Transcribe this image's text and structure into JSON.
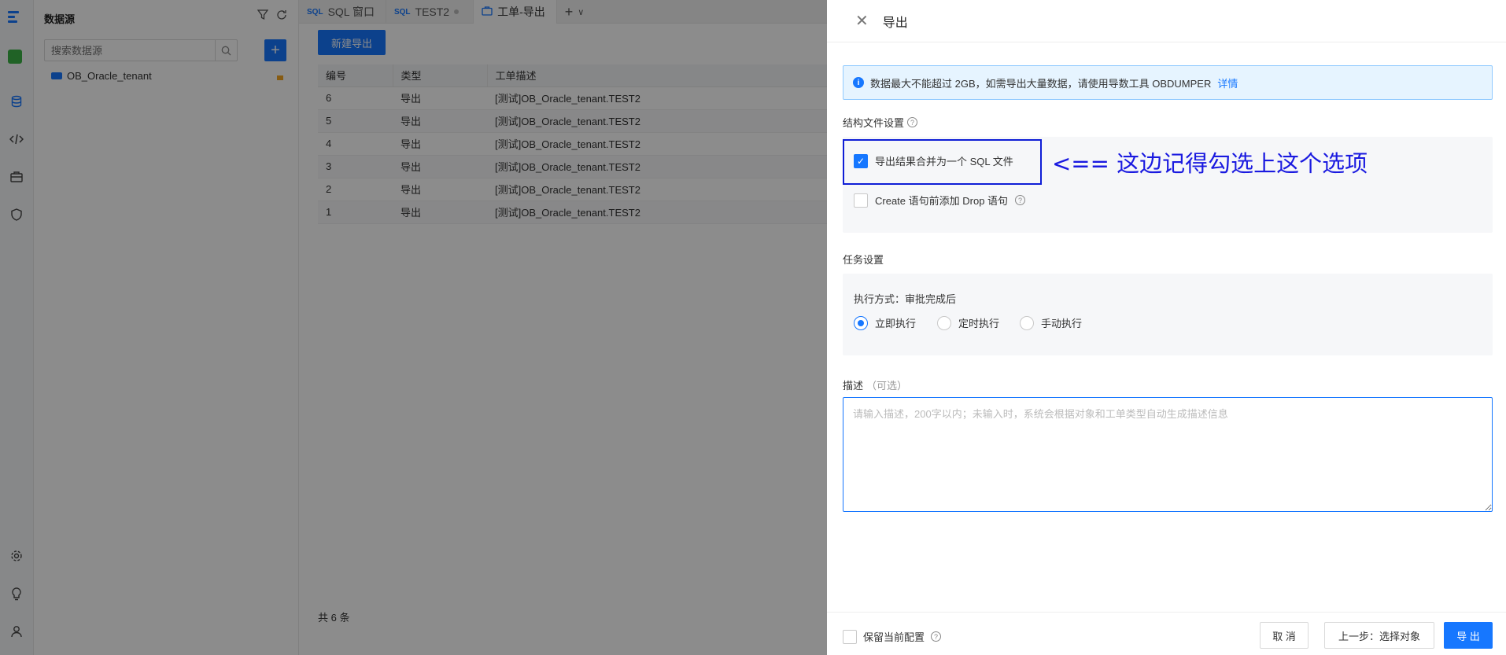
{
  "sidebar": {
    "title": "数据源",
    "search_placeholder": "搜索数据源",
    "tree_item": "OB_Oracle_tenant"
  },
  "tabs": [
    {
      "tag": "SQL",
      "label": "SQL 窗口"
    },
    {
      "tag": "SQL",
      "label": "TEST2"
    },
    {
      "label": "工单-导出"
    }
  ],
  "main": {
    "new_export_label": "新建导出",
    "columns": [
      "编号",
      "类型",
      "工单描述"
    ],
    "rows": [
      {
        "id": "6",
        "type": "导出",
        "desc": "[测试]OB_Oracle_tenant.TEST2"
      },
      {
        "id": "5",
        "type": "导出",
        "desc": "[测试]OB_Oracle_tenant.TEST2"
      },
      {
        "id": "4",
        "type": "导出",
        "desc": "[测试]OB_Oracle_tenant.TEST2"
      },
      {
        "id": "3",
        "type": "导出",
        "desc": "[测试]OB_Oracle_tenant.TEST2"
      },
      {
        "id": "2",
        "type": "导出",
        "desc": "[测试]OB_Oracle_tenant.TEST2"
      },
      {
        "id": "1",
        "type": "导出",
        "desc": "[测试]OB_Oracle_tenant.TEST2"
      }
    ],
    "total": "共 6 条"
  },
  "drawer": {
    "title": "导出",
    "alert_text": "数据最大不能超过 2GB，如需导出大量数据，请使用导数工具 OBDUMPER",
    "alert_link": "详情",
    "struct_label": "结构文件设置",
    "merge_sql_label": "导出结果合并为一个 SQL 文件",
    "merge_sql_checked": true,
    "drop_label": "Create 语句前添加 Drop 语句",
    "drop_checked": false,
    "annotation": "<== 这边记得勾选上这个选项",
    "task_label": "任务设置",
    "exec_mode": "执行方式：审批完成后",
    "radio_options": [
      "立即执行",
      "定时执行",
      "手动执行"
    ],
    "radio_selected": "立即执行",
    "desc_label": "描述",
    "desc_optional": "（可选）",
    "desc_placeholder": "请输入描述，200字以内；未输入时，系统会根据对象和工单类型自动生成描述信息",
    "keep_config_label": "保留当前配置",
    "cancel_label": "取 消",
    "prev_label": "上一步：选择对象",
    "export_label": "导 出"
  },
  "colors": {
    "accent": "#1677ff",
    "annotation": "#1a1ae0",
    "alert_bg": "#e6f4ff"
  }
}
